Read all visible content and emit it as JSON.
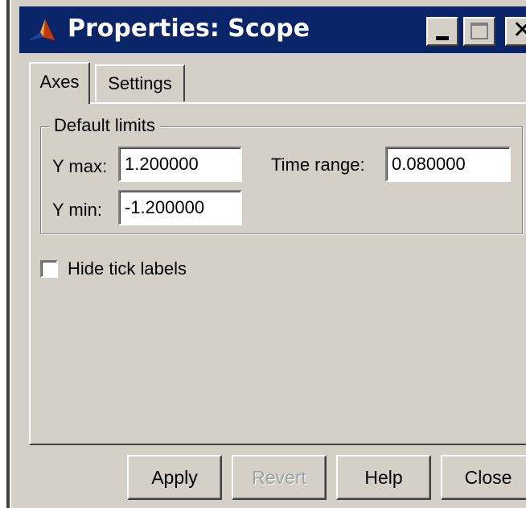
{
  "window": {
    "title": "Properties: Scope",
    "icon": "matlab-icon",
    "controls": {
      "minimize": "minimize-icon",
      "maximize": "maximize-icon",
      "close": "close-icon"
    }
  },
  "tabs": [
    {
      "label": "Axes",
      "selected": true
    },
    {
      "label": "Settings",
      "selected": false
    }
  ],
  "default_limits": {
    "group_label": "Default limits",
    "ymax_label": "Y max:",
    "ymax_value": "1.200000",
    "ymin_label": "Y min:",
    "ymin_value": "-1.200000",
    "time_range_label": "Time range:",
    "time_range_value": "0.080000"
  },
  "options": {
    "hide_tick_labels": {
      "label": "Hide tick labels",
      "checked": false
    }
  },
  "buttons": {
    "apply": "Apply",
    "revert": "Revert",
    "help": "Help",
    "close": "Close"
  },
  "colors": {
    "titlebar": "#0a246a",
    "face": "#d4d0c8",
    "disabled_text": "#a0a0a0"
  }
}
